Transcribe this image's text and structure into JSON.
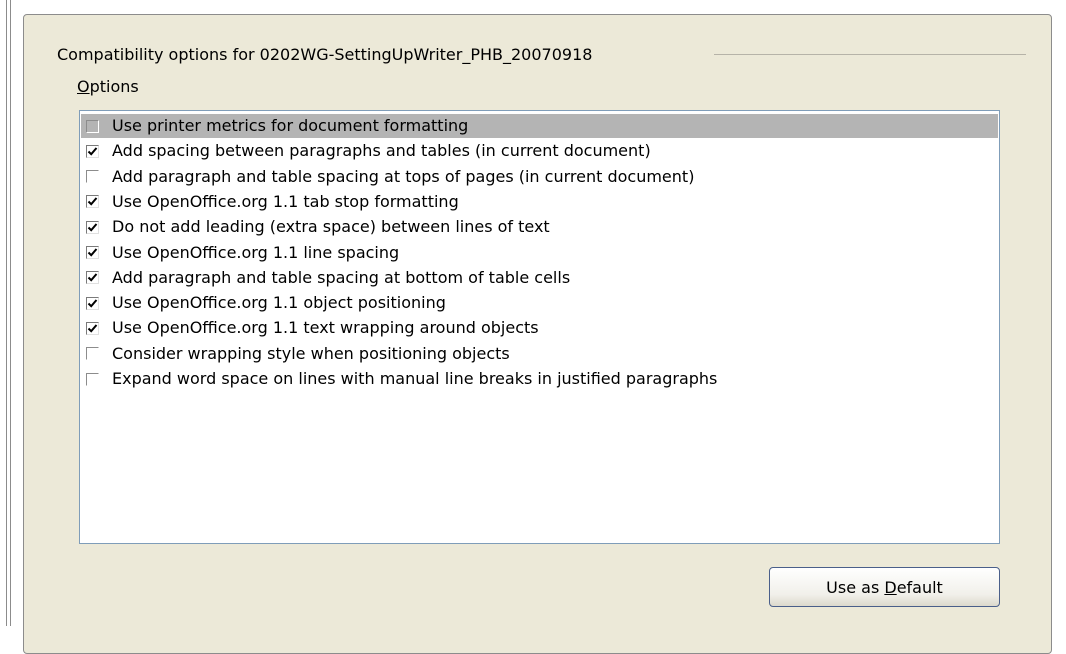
{
  "group": {
    "title": "Compatibility options for 0202WG-SettingUpWriter_PHB_20070918"
  },
  "options_label": {
    "mnemonic": "O",
    "rest": "ptions"
  },
  "options": [
    {
      "label": "Use printer metrics for document formatting",
      "checked": false,
      "selected": true
    },
    {
      "label": "Add spacing between paragraphs and tables (in current document)",
      "checked": true,
      "selected": false
    },
    {
      "label": "Add paragraph and table spacing at tops of pages (in current document)",
      "checked": false,
      "selected": false
    },
    {
      "label": "Use OpenOffice.org 1.1 tab stop formatting",
      "checked": true,
      "selected": false
    },
    {
      "label": "Do not add leading (extra space) between lines of text",
      "checked": true,
      "selected": false
    },
    {
      "label": "Use OpenOffice.org 1.1 line spacing",
      "checked": true,
      "selected": false
    },
    {
      "label": "Add paragraph and table spacing at bottom of table cells",
      "checked": true,
      "selected": false
    },
    {
      "label": "Use OpenOffice.org 1.1 object positioning",
      "checked": true,
      "selected": false
    },
    {
      "label": "Use OpenOffice.org 1.1 text wrapping around objects",
      "checked": true,
      "selected": false
    },
    {
      "label": "Consider wrapping style when positioning objects",
      "checked": false,
      "selected": false
    },
    {
      "label": "Expand word space on lines with manual line breaks in justified paragraphs",
      "checked": false,
      "selected": false
    }
  ],
  "default_button": {
    "prefix": "Use as ",
    "mnemonic": "D",
    "suffix": "efault"
  },
  "colors": {
    "panel_bg": "#ece9d8",
    "selection_bg": "#b4b4b4",
    "list_border": "#7f9db9"
  }
}
